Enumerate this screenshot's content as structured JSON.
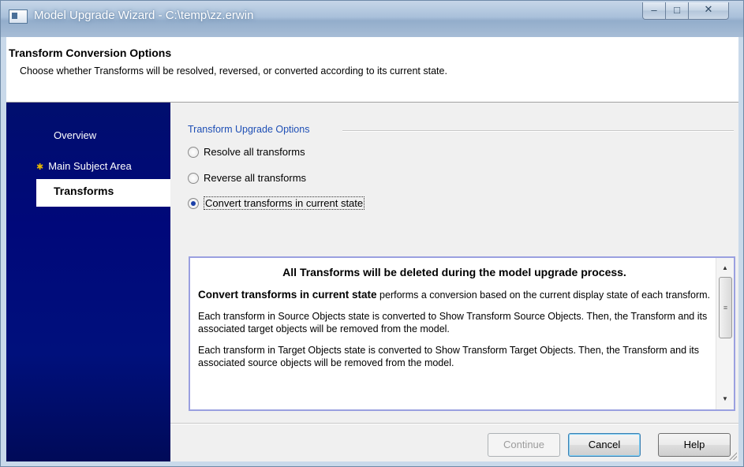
{
  "window": {
    "title": "Model Upgrade Wizard - C:\\temp\\zz.erwin",
    "controls": {
      "minimize": "–",
      "maximize": "□",
      "close": "✕"
    }
  },
  "header": {
    "title": "Transform Conversion Options",
    "description": "Choose whether Transforms will be resolved, reversed, or converted according to its current state."
  },
  "nav": {
    "items": [
      {
        "label": "Overview"
      },
      {
        "label": "Main Subject Area"
      },
      {
        "label": "Transforms",
        "active": true
      }
    ]
  },
  "options": {
    "group_label": "Transform Upgrade Options",
    "items": [
      {
        "label": "Resolve all transforms",
        "selected": false
      },
      {
        "label": "Reverse all transforms",
        "selected": false
      },
      {
        "label": "Convert transforms in current state",
        "selected": true
      }
    ]
  },
  "info": {
    "headline": "All Transforms will be deleted during the model upgrade process.",
    "p1_bold": "Convert transforms in current state",
    "p1_rest": " performs a conversion based on the current display state of each transform.",
    "p2": "Each transform in Source Objects state is converted to Show Transform Source Objects. Then, the Transform and its associated target objects will be removed from the model.",
    "p3": "Each transform in Target Objects state is converted to Show Transform Target Objects. Then, the Transform and its associated source objects will be removed from the model."
  },
  "buttons": {
    "continue": "Continue",
    "cancel": "Cancel",
    "help": "Help"
  },
  "colors": {
    "nav_background": "#00087a",
    "group_label": "#1e4fb5"
  }
}
